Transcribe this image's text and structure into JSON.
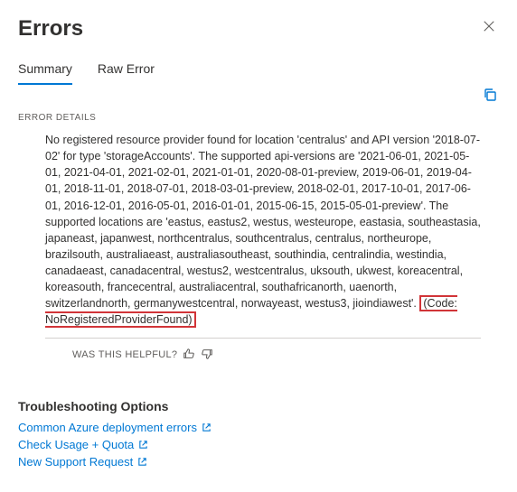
{
  "header": {
    "title": "Errors"
  },
  "tabs": {
    "summary": "Summary",
    "raw": "Raw Error"
  },
  "details": {
    "label": "ERROR DETAILS",
    "message": "No registered resource provider found for location 'centralus' and API version '2018-07-02' for type 'storageAccounts'. The supported api-versions are '2021-06-01, 2021-05-01, 2021-04-01, 2021-02-01, 2021-01-01, 2020-08-01-preview, 2019-06-01, 2019-04-01, 2018-11-01, 2018-07-01, 2018-03-01-preview, 2018-02-01, 2017-10-01, 2017-06-01, 2016-12-01, 2016-05-01, 2016-01-01, 2015-06-15, 2015-05-01-preview'. The supported locations are 'eastus, eastus2, westus, westeurope, eastasia, southeastasia, japaneast, japanwest, northcentralus, southcentralus, centralus, northeurope, brazilsouth, australiaeast, australiasoutheast, southindia, centralindia, westindia, canadaeast, canadacentral, westus2, westcentralus, uksouth, ukwest, koreacentral, koreasouth, francecentral, australiacentral, southafricanorth, uaenorth, switzerlandnorth, germanywestcentral, norwayeast, westus3, jioindiawest'. ",
    "code": "(Code: NoRegisteredProviderFound)"
  },
  "helpful": {
    "label": "WAS THIS HELPFUL?"
  },
  "troubleshoot": {
    "title": "Troubleshooting Options",
    "links": [
      "Common Azure deployment errors",
      "Check Usage + Quota",
      "New Support Request"
    ]
  }
}
